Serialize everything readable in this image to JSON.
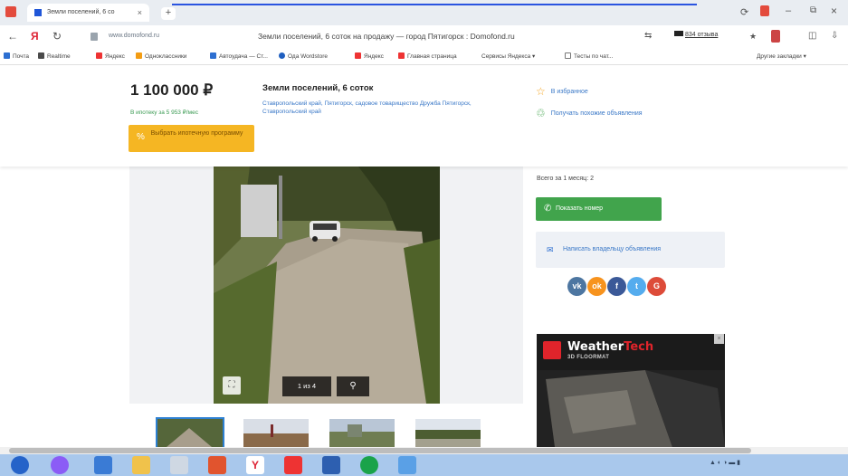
{
  "browser": {
    "tab_title": "Земли поселений, 6 со",
    "url": "www.domofond.ru",
    "page_title": "Земли поселений, 6 соток на продажу — город Пятигорск : Domofond.ru",
    "reviews": "834 отзыва",
    "bookmarks": [
      "Почта",
      "Realtime",
      "Яндекс",
      "Одноклассники",
      "Автоудача — Ст...",
      "Ода Wordstore",
      "Яндекс",
      "Главная страница",
      "Сервисы Яндекса ▾",
      "Тесты по чат...",
      "Другие закладки ▾"
    ]
  },
  "listing": {
    "price": "1 100 000 ₽",
    "price_sub": "В ипотеку за 5 953 ₽/мес",
    "mortgage_button": "Выбрать ипотечную программу",
    "title": "Земли поселений, 6 соток",
    "address": "Ставропольский край, Пятигорск, садовое товарищество Дружба Пятигорск, Ставропольский край",
    "favorite_link": "В избранное",
    "similar_link": "Получать похожие объявления"
  },
  "gallery": {
    "counter": "1 из 4",
    "thumbnail_count": 4
  },
  "seller": {
    "note": "Всего за 1 месяц: 2",
    "show_phone": "Показать номер",
    "write_owner": "Написать владельцу объявления",
    "socials": [
      {
        "name": "VK",
        "glyph": "vk",
        "color": "#4d76a1"
      },
      {
        "name": "Odnoklassniki",
        "glyph": "ok",
        "color": "#f7931e"
      },
      {
        "name": "Facebook",
        "glyph": "f",
        "color": "#3b5998"
      },
      {
        "name": "Twitter",
        "glyph": "t",
        "color": "#55acee"
      },
      {
        "name": "Google",
        "glyph": "G",
        "color": "#dd4b39"
      }
    ]
  },
  "ad": {
    "brand_a": "Weather",
    "brand_b": "Tech",
    "sub": "3D FLOORMAT"
  },
  "colors": {
    "accent_green": "#41a44c",
    "accent_orange": "#f5b623",
    "link_blue": "#3a78c7"
  }
}
